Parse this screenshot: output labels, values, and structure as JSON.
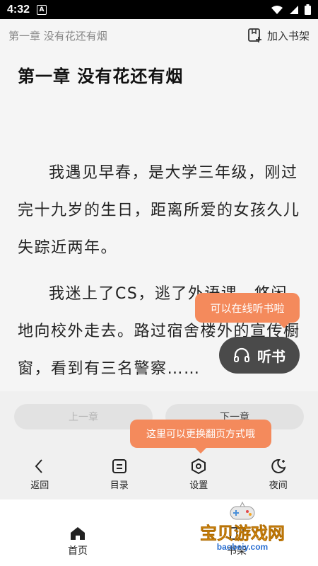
{
  "status_bar": {
    "time": "4:32",
    "app_badge": "A"
  },
  "header": {
    "chapter_name": "第一章 没有花还有烟",
    "bookshelf_label": "加入书架"
  },
  "chapter": {
    "title": "第一章 没有花还有烟",
    "paragraphs": [
      "我遇见早春，是大学三年级，刚过完十九岁的生日，距离所爱的女孩久儿失踪近两年。",
      "我迷上了CS，逃了外语课，悠闲地向校外走去。路过宿舍楼外的宣传橱窗，看到有三名警察……"
    ]
  },
  "tooltips": {
    "listen_hint": "可以在线听书啦",
    "flip_hint": "这里可以更换翻页方式哦"
  },
  "listen_button": {
    "label": "听书"
  },
  "chapter_nav": {
    "prev": "上一章",
    "next": "下一章"
  },
  "toolbar": {
    "items": [
      {
        "label": "返回",
        "icon": "back-arrow-icon"
      },
      {
        "label": "目录",
        "icon": "catalog-icon"
      },
      {
        "label": "设置",
        "icon": "settings-hexagon-icon"
      },
      {
        "label": "夜间",
        "icon": "night-moon-icon"
      }
    ]
  },
  "bottom_nav": {
    "home": "首页",
    "shelf": "书架"
  },
  "watermark": {
    "text": "宝贝游戏网",
    "url": "baobeiy.com"
  },
  "colors": {
    "accent": "#f48a5c",
    "listen_bg": "#4a4a4a",
    "panel_bg": "#f0f0f0"
  }
}
